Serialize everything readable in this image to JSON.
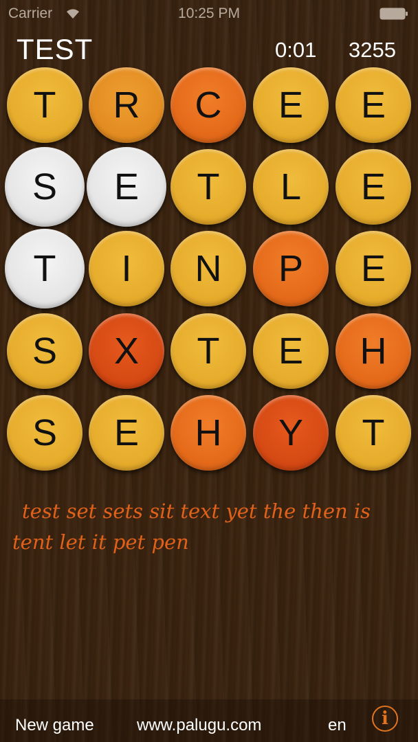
{
  "status_bar": {
    "carrier": "Carrier",
    "time": "10:25 PM"
  },
  "header": {
    "title": "TEST",
    "timer": "0:01",
    "score": "3255"
  },
  "board": {
    "rows": [
      [
        {
          "letter": "T",
          "color": "yellow"
        },
        {
          "letter": "R",
          "color": "light-orange"
        },
        {
          "letter": "C",
          "color": "orange"
        },
        {
          "letter": "E",
          "color": "yellow"
        },
        {
          "letter": "E",
          "color": "yellow"
        }
      ],
      [
        {
          "letter": "S",
          "color": "white"
        },
        {
          "letter": "E",
          "color": "white"
        },
        {
          "letter": "T",
          "color": "yellow"
        },
        {
          "letter": "L",
          "color": "yellow"
        },
        {
          "letter": "E",
          "color": "yellow"
        }
      ],
      [
        {
          "letter": "T",
          "color": "white"
        },
        {
          "letter": "I",
          "color": "yellow"
        },
        {
          "letter": "N",
          "color": "yellow"
        },
        {
          "letter": "P",
          "color": "orange"
        },
        {
          "letter": "E",
          "color": "yellow"
        }
      ],
      [
        {
          "letter": "S",
          "color": "yellow"
        },
        {
          "letter": "X",
          "color": "red-orange"
        },
        {
          "letter": "T",
          "color": "yellow"
        },
        {
          "letter": "E",
          "color": "yellow"
        },
        {
          "letter": "H",
          "color": "orange"
        }
      ],
      [
        {
          "letter": "S",
          "color": "yellow"
        },
        {
          "letter": "E",
          "color": "yellow"
        },
        {
          "letter": "H",
          "color": "orange"
        },
        {
          "letter": "Y",
          "color": "red-orange"
        },
        {
          "letter": "T",
          "color": "yellow"
        }
      ]
    ]
  },
  "found_words": "test set sets sit text yet the then is tent let it pet pen",
  "footer": {
    "new_game": "New game",
    "website": "www.palugu.com",
    "language": "en",
    "info_label": "i"
  },
  "colors": {
    "accent": "#e2741f",
    "found_words": "#e0621a",
    "background": "#3a230f"
  }
}
